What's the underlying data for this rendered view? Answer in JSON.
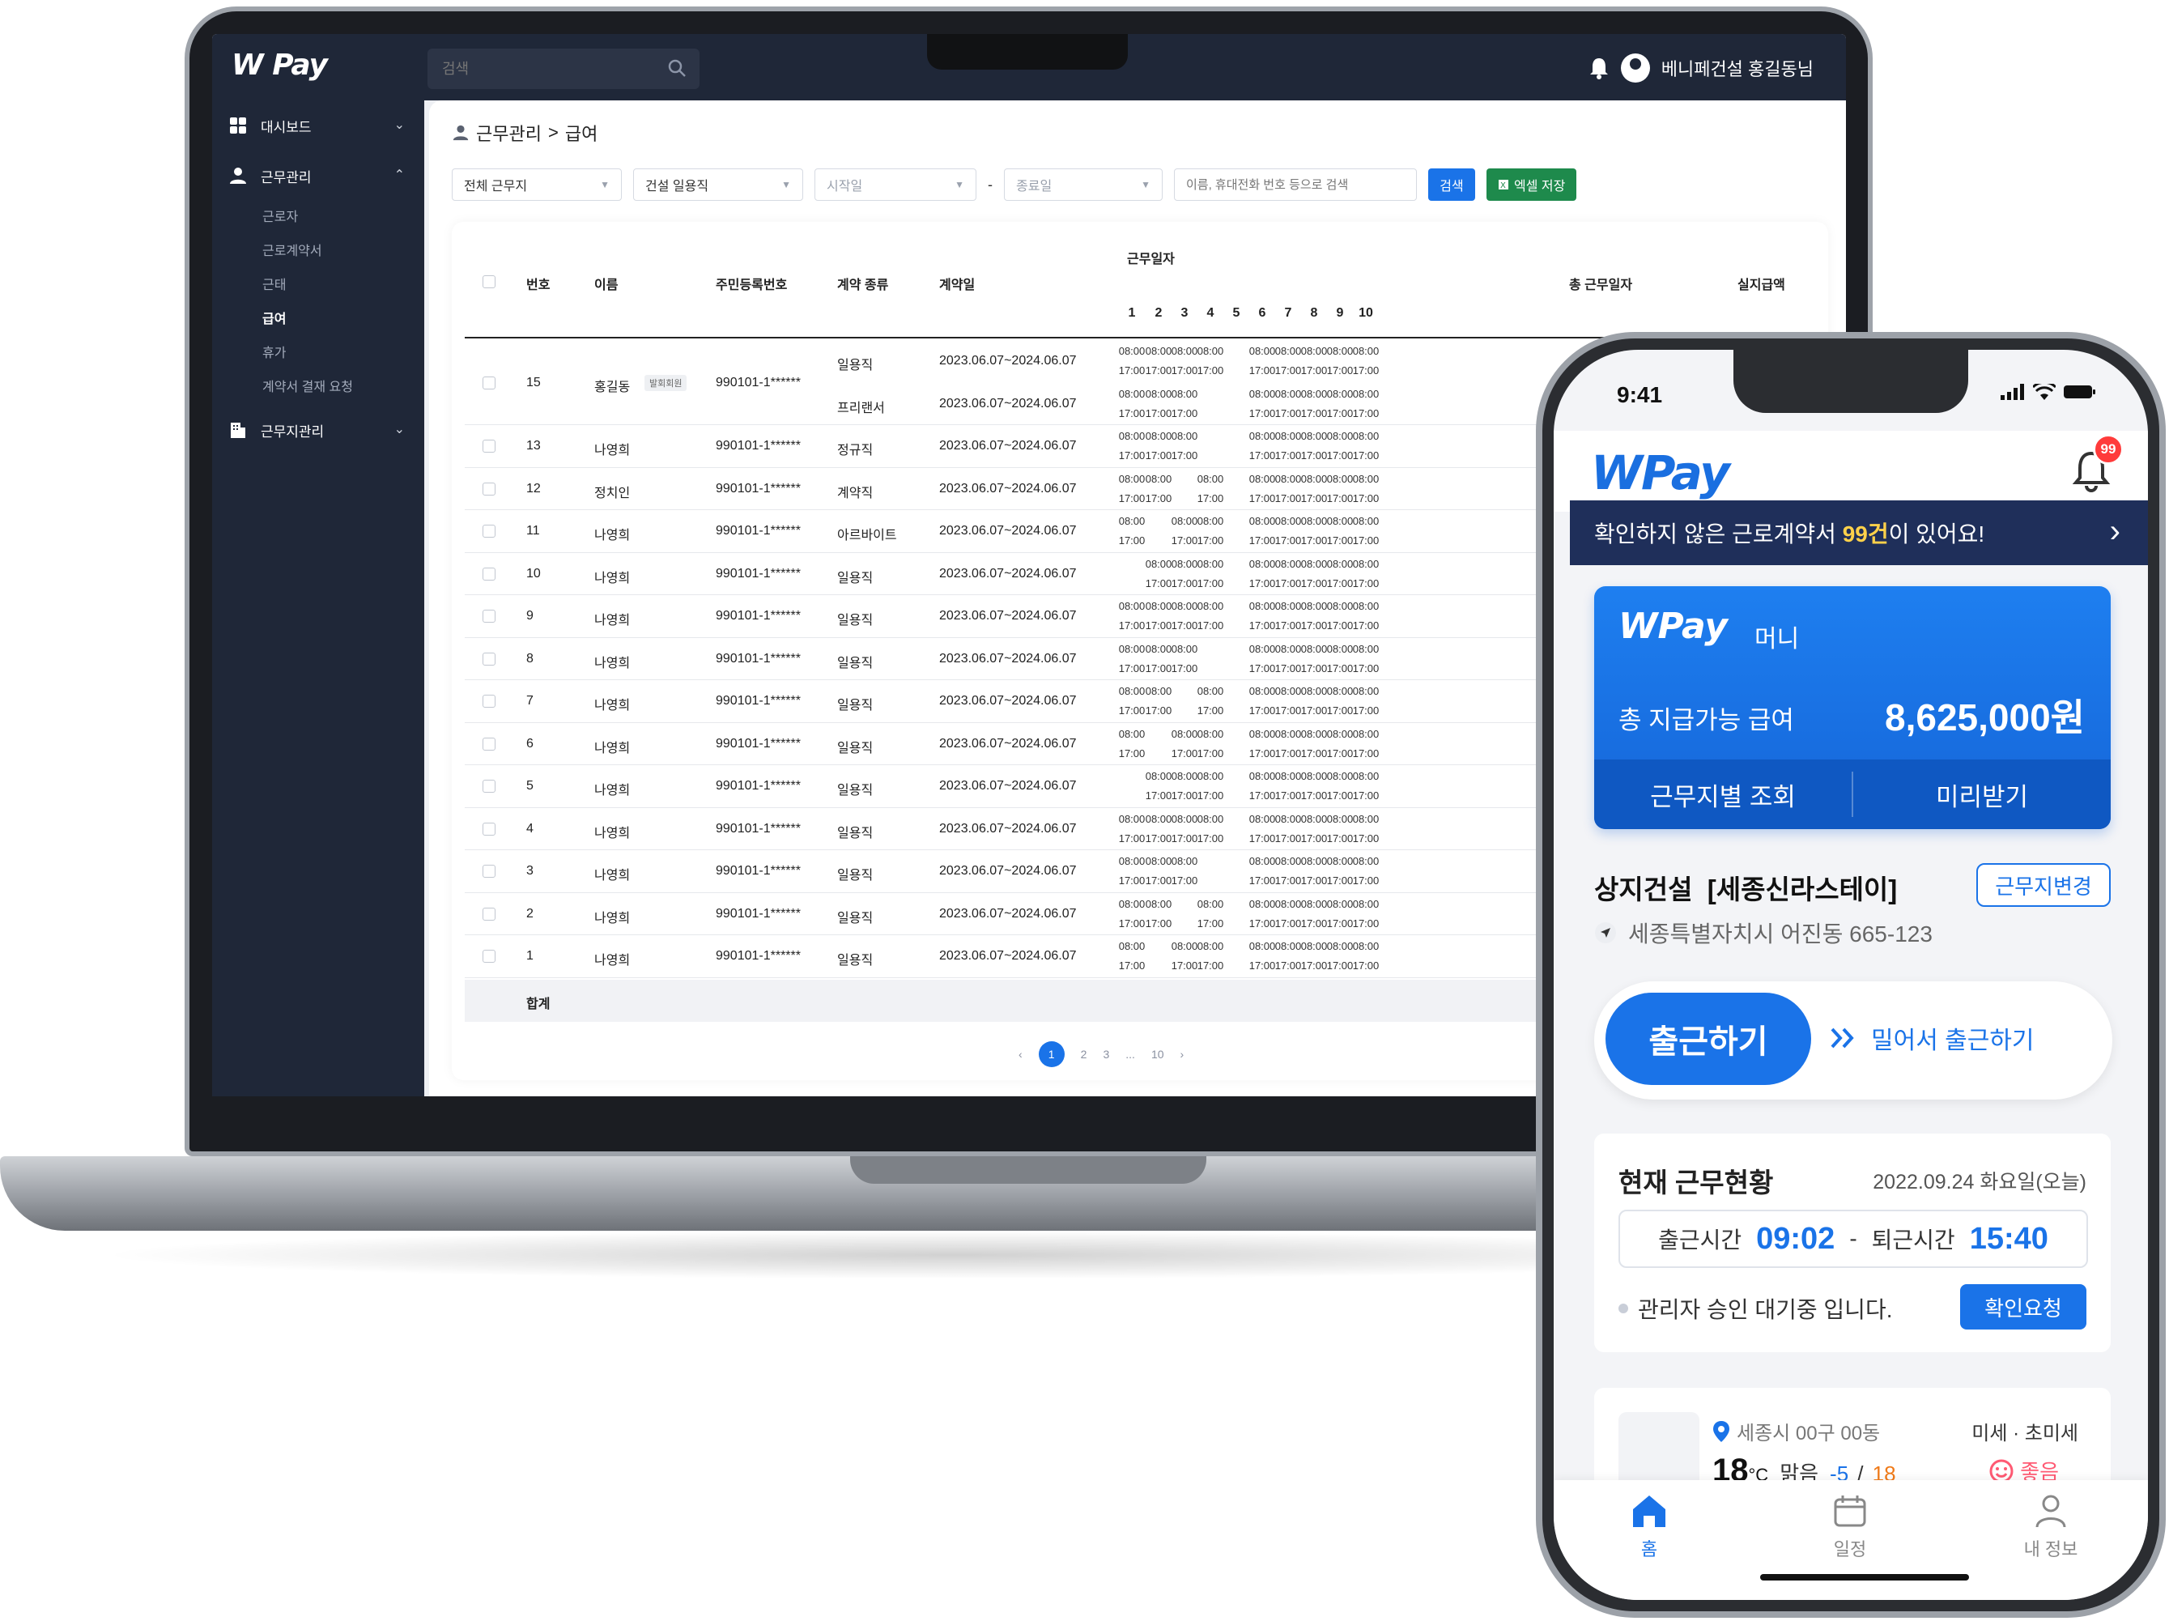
{
  "desktop": {
    "logo": "W Pay",
    "search_placeholder": "검색",
    "user_name": "베니페건설 홍길동님",
    "sidebar": {
      "dashboard": "대시보드",
      "work_mgmt": "근무관리",
      "sub_items": [
        "근로자",
        "근로계약서",
        "근태",
        "급여",
        "휴가",
        "계약서 결재 요청"
      ],
      "site_mgmt": "근무지관리"
    },
    "breadcrumb": {
      "parent": "근무관리",
      "separator": ">",
      "current": "급여"
    },
    "filters": {
      "site": "전체 근무지",
      "type": "건설 일용직",
      "start": "시작일",
      "end": "종료일",
      "dash": "-",
      "keyword_placeholder": "이름, 휴대전화 번호 등으로 검색",
      "search_button": "검색",
      "excel_button": "엑셀 저장"
    },
    "table": {
      "headers": {
        "no": "번호",
        "name": "이름",
        "rrn": "주민등록번호",
        "contract_type": "계약 종류",
        "contract_date": "계약일",
        "work_days": "근무일자",
        "total_days": "총 근무일자",
        "actual_pay": "실지급액"
      },
      "days": [
        "1",
        "2",
        "3",
        "4",
        "5",
        "6",
        "7",
        "8",
        "9",
        "10"
      ],
      "time_in": "08:00",
      "time_out": "17:00",
      "rows": [
        {
          "no": "15",
          "name": "홍길동",
          "badge": "발회회원",
          "rrn": "990101-1******",
          "types": [
            "일용직",
            "프리랜서"
          ],
          "date": "2023.06.07~2024.06.07"
        },
        {
          "no": "13",
          "name": "나영희",
          "rrn": "990101-1******",
          "types": [
            "정규직"
          ],
          "date": "2023.06.07~2024.06.07"
        },
        {
          "no": "12",
          "name": "정치인",
          "rrn": "990101-1******",
          "types": [
            "계약직"
          ],
          "date": "2023.06.07~2024.06.07"
        },
        {
          "no": "11",
          "name": "나영희",
          "rrn": "990101-1******",
          "types": [
            "아르바이트"
          ],
          "date": "2023.06.07~2024.06.07"
        },
        {
          "no": "10",
          "name": "나영희",
          "rrn": "990101-1******",
          "types": [
            "일용직"
          ],
          "date": "2023.06.07~2024.06.07"
        },
        {
          "no": "9",
          "name": "나영희",
          "rrn": "990101-1******",
          "types": [
            "일용직"
          ],
          "date": "2023.06.07~2024.06.07"
        },
        {
          "no": "8",
          "name": "나영희",
          "rrn": "990101-1******",
          "types": [
            "일용직"
          ],
          "date": "2023.06.07~2024.06.07"
        },
        {
          "no": "7",
          "name": "나영희",
          "rrn": "990101-1******",
          "types": [
            "일용직"
          ],
          "date": "2023.06.07~2024.06.07"
        },
        {
          "no": "6",
          "name": "나영희",
          "rrn": "990101-1******",
          "types": [
            "일용직"
          ],
          "date": "2023.06.07~2024.06.07"
        },
        {
          "no": "5",
          "name": "나영희",
          "rrn": "990101-1******",
          "types": [
            "일용직"
          ],
          "date": "2023.06.07~2024.06.07"
        },
        {
          "no": "4",
          "name": "나영희",
          "rrn": "990101-1******",
          "types": [
            "일용직"
          ],
          "date": "2023.06.07~2024.06.07"
        },
        {
          "no": "3",
          "name": "나영희",
          "rrn": "990101-1******",
          "types": [
            "일용직"
          ],
          "date": "2023.06.07~2024.06.07"
        },
        {
          "no": "2",
          "name": "나영희",
          "rrn": "990101-1******",
          "types": [
            "일용직"
          ],
          "date": "2023.06.07~2024.06.07"
        },
        {
          "no": "1",
          "name": "나영희",
          "rrn": "990101-1******",
          "types": [
            "일용직"
          ],
          "date": "2023.06.07~2024.06.07"
        }
      ],
      "sum_label": "합계"
    },
    "pagination": {
      "prev": "‹",
      "pages": [
        "1",
        "2",
        "3"
      ],
      "ellipsis": "...",
      "last": "10",
      "next": "›",
      "active": "1"
    }
  },
  "mobile": {
    "status_time": "9:41",
    "logo": "WPay",
    "bell_badge": "99",
    "notice": {
      "prefix": "확인하지 않은 근로계약서 ",
      "highlight": "99건",
      "suffix": "이 있어요!"
    },
    "money_card": {
      "logo": "WPay",
      "logo_sub": "머니",
      "label": "총 지급가능 급여",
      "amount": "8,625,000원",
      "btn_site": "근무지별 조회",
      "btn_advance": "미리받기"
    },
    "site": {
      "name": "상지건설  [세종신라스테이]",
      "change_button": "근무지변경",
      "address": "세종특별자치시 어진동 665-123"
    },
    "commute": {
      "checkin": "출근하기",
      "push_checkin": "밀어서 출근하기"
    },
    "status": {
      "title": "현재 근무현황",
      "date": "2022.09.24 화요일(오늘)",
      "in_label": "출근시간",
      "in_time": "09:02",
      "dash": "-",
      "out_label": "퇴근시간",
      "out_time": "15:40",
      "wait_text": "관리자 승인 대기중 입니다.",
      "confirm_button": "확인요청"
    },
    "weather": {
      "location": "세종시 00구 00동",
      "temp": "18",
      "deg": "°C",
      "condition": "맑음",
      "min": "-5",
      "slash": "/",
      "max": "18",
      "dust_label": "미세 · 초미세",
      "dust_status": "좋음"
    },
    "tabs": [
      "홈",
      "일정",
      "내 정보"
    ],
    "colors": {
      "primary": "#1a73e8",
      "notice_bg": "#1f2f5a",
      "highlight": "#ffd14a",
      "badge": "#ff3b3b"
    }
  }
}
